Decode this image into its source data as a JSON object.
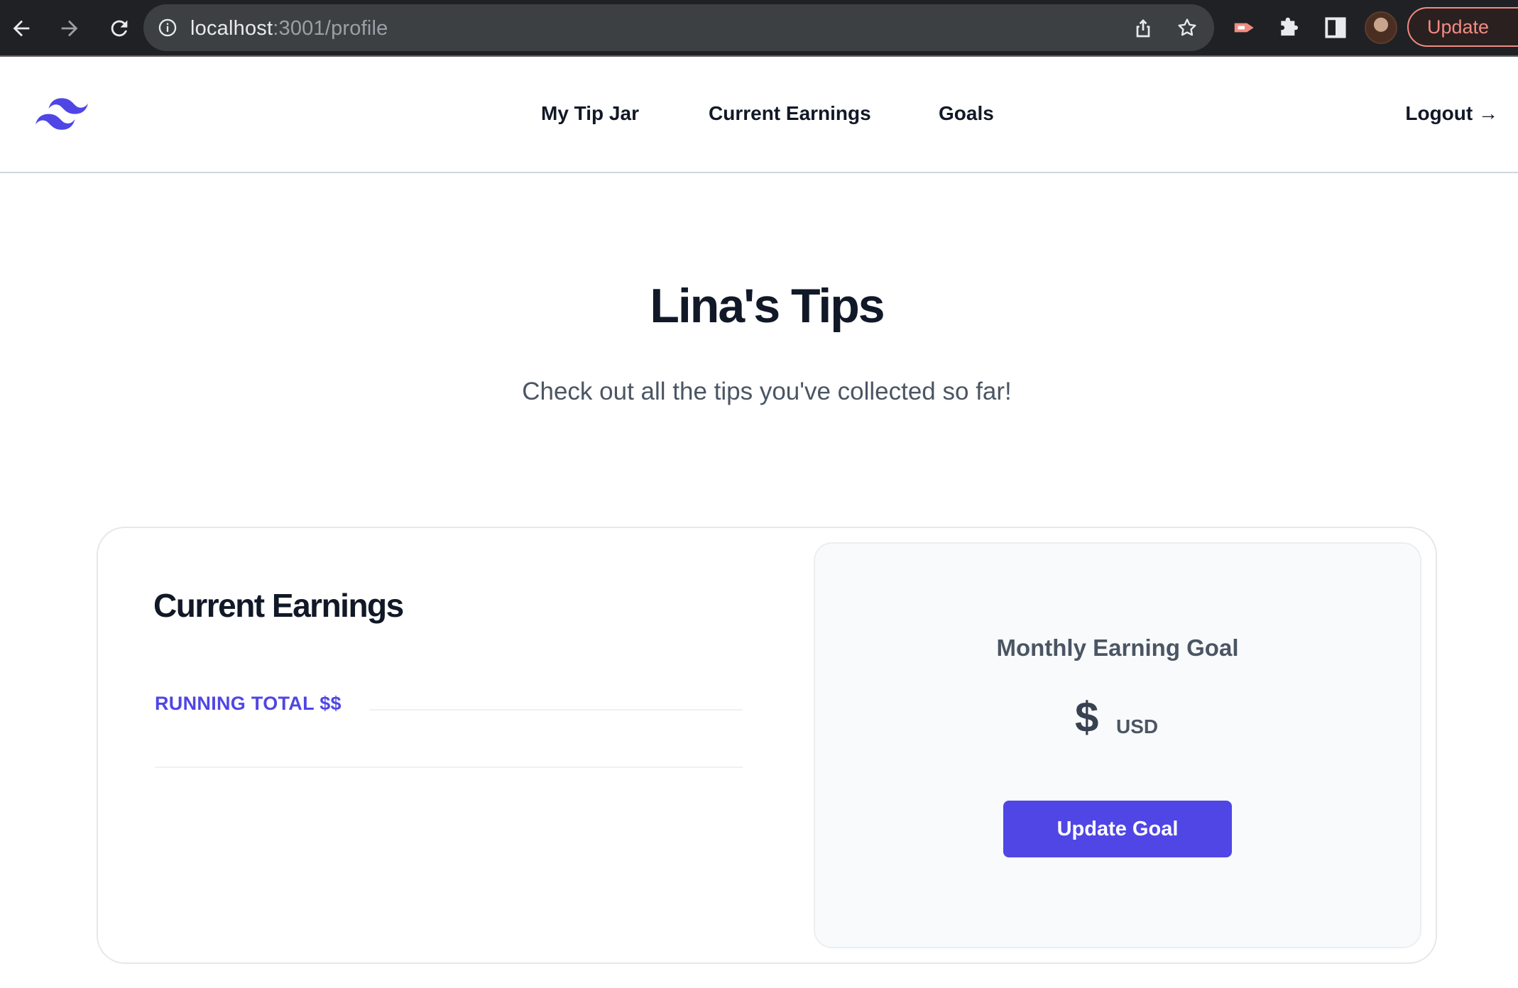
{
  "browser": {
    "url_host": "localhost",
    "url_path": ":3001/profile",
    "update_label": "Update",
    "icons": [
      "back-arrow-icon",
      "forward-arrow-icon",
      "reload-icon",
      "info-icon",
      "share-icon",
      "star-icon",
      "extension-icon",
      "puzzle-icon",
      "sidepanel-icon",
      "avatar",
      "menu-icon"
    ]
  },
  "header": {
    "logo": "tailwind-logo-icon",
    "nav": [
      "My Tip Jar",
      "Current Earnings",
      "Goals"
    ],
    "logout": "Logout →"
  },
  "hero": {
    "title": "Lina's Tips",
    "subtitle": "Check out all the tips you've collected so far!"
  },
  "earnings": {
    "title": "Current Earnings",
    "running_total_label": "RUNNING TOTAL $$"
  },
  "goal": {
    "label": "Monthly Earning Goal",
    "amount": "$",
    "currency": "USD",
    "button": "Update Goal"
  },
  "colors": {
    "accent": "#4f46e5",
    "chrome_bg": "#202124",
    "update_pill": "#f28b82"
  }
}
